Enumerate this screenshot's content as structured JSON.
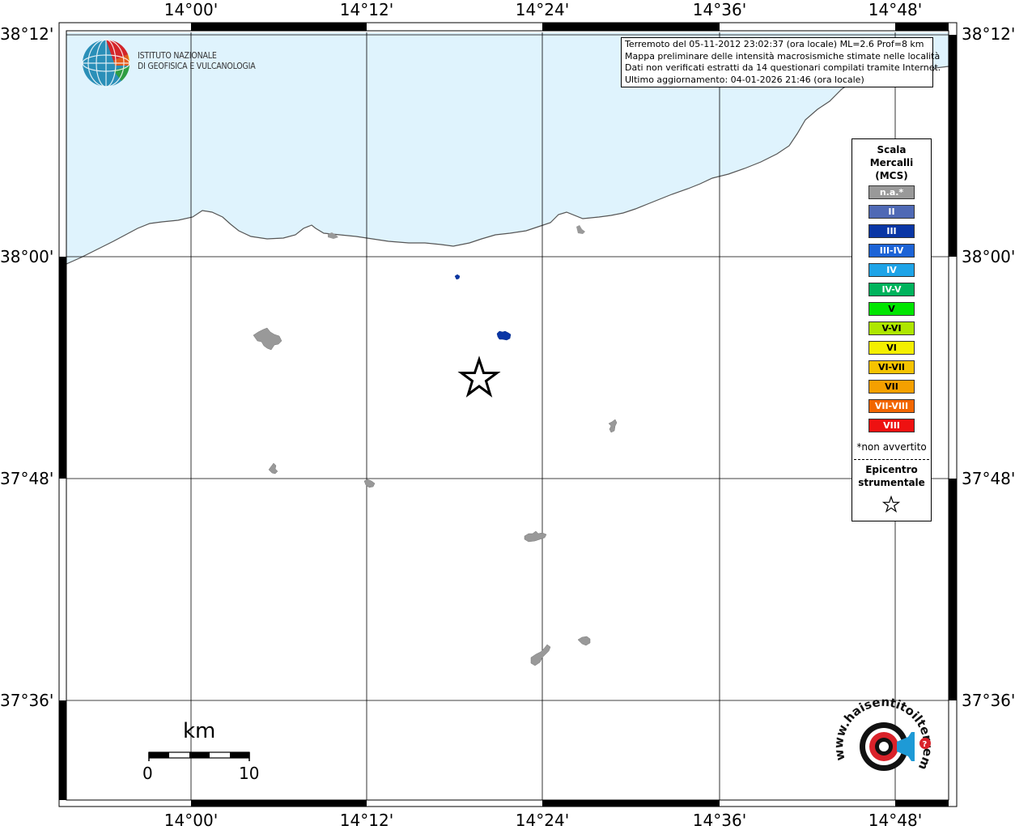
{
  "map": {
    "lon_labels": [
      "14°00'",
      "14°12'",
      "14°24'",
      "14°36'",
      "14°48'"
    ],
    "lat_labels": [
      "38°12'",
      "38°00'",
      "37°48'",
      "37°36'"
    ],
    "colors": {
      "sea": "#dff3fd",
      "coast": "#555555",
      "grid": "#000000",
      "locality_na": "#999999",
      "locality_III": "#0a36a5"
    }
  },
  "info": {
    "line1": "Terremoto del 05-11-2012 23:02:37 (ora locale) ML=2.6 Prof=8 km",
    "line2": "Mappa preliminare delle intensità macrosismiche stimate nelle località",
    "line3": "Dati non verificati estratti da 14 questionari compilati tramite Internet.",
    "line4": "Ultimo aggiornamento: 04-01-2026 21:46 (ora locale)"
  },
  "logo": {
    "line1": "ISTITUTO NAZIONALE",
    "line2": "DI GEOFISICA E VULCANOLOGIA",
    "hst_text": "www.haisentitoilterremoto.it",
    "hst_icon": "megaphone-icon"
  },
  "legend": {
    "title_line1": "Scala",
    "title_line2": "Mercalli",
    "title_line3": "(MCS)",
    "items": [
      {
        "label": "n.a.*",
        "color": "#999999"
      },
      {
        "label": "II",
        "color": "#4f69b5"
      },
      {
        "label": "III",
        "color": "#0a36a5"
      },
      {
        "label": "III-IV",
        "color": "#1c63d6"
      },
      {
        "label": "IV",
        "color": "#1ea4e8"
      },
      {
        "label": "IV-V",
        "color": "#00b35c"
      },
      {
        "label": "V",
        "color": "#00e600"
      },
      {
        "label": "V-VI",
        "color": "#aee600"
      },
      {
        "label": "VI",
        "color": "#f4ef00"
      },
      {
        "label": "VI-VII",
        "color": "#f5c300"
      },
      {
        "label": "VII",
        "color": "#f5a000"
      },
      {
        "label": "VII-VIII",
        "color": "#f26600"
      },
      {
        "label": "VIII",
        "color": "#ee1111"
      }
    ],
    "note": "*non avvertito",
    "epicenter_line1": "Epicentro",
    "epicenter_line2": "strumentale",
    "epicenter_icon": "star-icon"
  },
  "scale": {
    "unit": "km",
    "start": "0",
    "end": "10"
  }
}
